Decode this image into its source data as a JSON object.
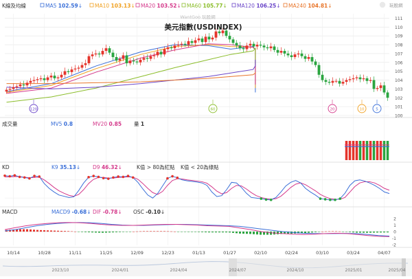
{
  "watermark": "WantGoo 玩股網",
  "logo_text": "玩股網",
  "chart_title": "美元指數(USDINDEX)",
  "colors": {
    "up": "#e5342b",
    "down": "#2aa53f",
    "ma5": "#3a6fd8",
    "ma10": "#f0a020",
    "ma20": "#d4388a",
    "ma60": "#8bbd2a",
    "ma120": "#6a45c8",
    "ma240": "#e8752a",
    "k": "#3a6fd8",
    "d": "#d4388a",
    "macd": "#3a6fd8",
    "dif": "#d4388a",
    "grid": "#e4e4e4"
  },
  "price_panel": {
    "label": "K線及均線",
    "legend": [
      {
        "name": "MA5",
        "value": "102.59",
        "dir": "↓",
        "key": "ma5"
      },
      {
        "name": "MA10",
        "value": "103.13",
        "dir": "↓",
        "key": "ma10"
      },
      {
        "name": "MA20",
        "value": "103.52",
        "dir": "↓",
        "key": "ma20"
      },
      {
        "name": "MA60",
        "value": "105.77",
        "dir": "↓",
        "key": "ma60"
      },
      {
        "name": "MA120",
        "value": "106.25",
        "dir": "↓",
        "key": "ma120"
      },
      {
        "name": "MA240",
        "value": "104.81",
        "dir": "↓",
        "key": "ma240"
      }
    ],
    "y_ticks": [
      "111",
      "110",
      "109",
      "108",
      "107",
      "106",
      "105",
      "104",
      "103",
      "102",
      "101",
      "100"
    ],
    "markers": [
      {
        "text": "120",
        "color": "#6a45c8"
      },
      {
        "text": "60",
        "color": "#8bbd2a"
      },
      {
        "text": "20",
        "color": "#d4388a"
      },
      {
        "text": "10",
        "color": "#f0a020"
      },
      {
        "text": "5",
        "color": "#3a6fd8"
      }
    ]
  },
  "volume_panel": {
    "label": "成交量",
    "legend": [
      {
        "name": "MV5",
        "value": "0.8",
        "key": "ma5"
      },
      {
        "name": "MV20",
        "value": "0.85",
        "key": "ma20"
      },
      {
        "name": "量",
        "value": "1",
        "key": "plain"
      }
    ]
  },
  "kd_panel": {
    "label": "KD",
    "legend": [
      {
        "name": "K9",
        "value": "35.13",
        "dir": "↓",
        "key": "k"
      },
      {
        "name": "D9",
        "value": "46.32",
        "dir": "↓",
        "key": "d"
      }
    ],
    "notes": [
      "K值 > 80為紅點",
      "K值 < 20為綠點"
    ]
  },
  "macd_panel": {
    "label": "MACD",
    "legend": [
      {
        "name": "MACD9",
        "value": "-0.68",
        "dir": "↓",
        "key": "macd"
      },
      {
        "name": "DIF",
        "value": "-0.78",
        "dir": "↓",
        "key": "dif"
      },
      {
        "name": "OSC",
        "value": "-0.10",
        "dir": "↓",
        "key": "plain"
      }
    ],
    "y_ticks": [
      "2",
      "1",
      "0",
      "-1",
      "-2"
    ]
  },
  "x_axis_labels": [
    "10/14",
    "10/28",
    "11/11",
    "11/25",
    "12/09",
    "12/23",
    "01/13",
    "01/27",
    "02/10",
    "02/24",
    "03/10",
    "03/24",
    "04/07"
  ],
  "navigator_labels": [
    "2023/10",
    "2024/01",
    "2024/04",
    "2024/07",
    "2024/10",
    "2025/01",
    "2025/04"
  ],
  "chart_data": {
    "type": "candlestick",
    "title": "美元指數(USDINDEX)",
    "ylim": [
      100,
      111.5
    ],
    "x_labels": [
      "10/14",
      "10/28",
      "11/11",
      "11/25",
      "12/09",
      "12/23",
      "01/13",
      "01/27",
      "02/10",
      "02/24",
      "03/10",
      "03/24",
      "04/07"
    ],
    "close": [
      102.9,
      103.0,
      103.2,
      103.3,
      103.5,
      103.4,
      103.7,
      103.9,
      104.0,
      104.1,
      104.2,
      104.0,
      104.3,
      104.5,
      104.2,
      104.3,
      104.6,
      105.0,
      104.9,
      105.2,
      105.3,
      105.4,
      105.7,
      105.9,
      106.7,
      106.9,
      107.0,
      106.9,
      107.3,
      107.6,
      107.1,
      106.6,
      106.2,
      106.4,
      106.8,
      105.9,
      106.2,
      106.1,
      106.0,
      106.3,
      106.5,
      106.4,
      106.7,
      106.8,
      107.2,
      106.9,
      107.5,
      107.7,
      107.6,
      107.9,
      108.0,
      108.1,
      108.0,
      108.4,
      108.2,
      108.5,
      108.7,
      108.3,
      108.9,
      108.6,
      108.8,
      109.5,
      109.3,
      109.6,
      109.0,
      108.6,
      108.2,
      107.9,
      107.6,
      107.5,
      107.9,
      108.1,
      107.8,
      108.0,
      107.9,
      107.7,
      107.6,
      107.8,
      107.4,
      107.1,
      107.3,
      107.0,
      106.8,
      106.6,
      106.9,
      107.0,
      106.7,
      106.4,
      106.6,
      106.1,
      105.7,
      104.6,
      104.0,
      103.8,
      103.7,
      103.9,
      103.9,
      103.6,
      103.8,
      104.0,
      104.1,
      104.2,
      104.3,
      104.1,
      104.2,
      103.9,
      104.0,
      103.0,
      103.1,
      103.4,
      102.6,
      102.0
    ],
    "series": [
      {
        "name": "MA5",
        "points": [
          [
            0,
            102.7
          ],
          [
            20,
            103.6
          ],
          [
            40,
            105.6
          ],
          [
            60,
            107.2
          ],
          [
            75,
            108.0
          ],
          [
            90,
            107.9
          ],
          [
            100,
            107.5
          ],
          [
            110,
            107.8
          ],
          [
            120,
            107.4
          ],
          [
            130,
            106.5
          ],
          [
            140,
            104.0
          ],
          [
            150,
            103.9
          ],
          [
            160,
            104.3
          ],
          [
            165,
            103.5
          ],
          [
            170,
            102.6
          ]
        ]
      },
      {
        "name": "MA10",
        "points": [
          [
            0,
            102.6
          ],
          [
            20,
            103.4
          ],
          [
            40,
            105.3
          ],
          [
            60,
            106.9
          ],
          [
            75,
            107.8
          ],
          [
            90,
            108.0
          ],
          [
            100,
            107.8
          ],
          [
            110,
            107.7
          ],
          [
            120,
            107.5
          ],
          [
            130,
            106.9
          ],
          [
            140,
            104.8
          ],
          [
            150,
            104.1
          ],
          [
            160,
            104.1
          ],
          [
            165,
            103.8
          ],
          [
            170,
            103.1
          ]
        ]
      },
      {
        "name": "MA20",
        "points": [
          [
            0,
            102.5
          ],
          [
            20,
            103.1
          ],
          [
            40,
            104.9
          ],
          [
            60,
            106.5
          ],
          [
            75,
            107.4
          ],
          [
            90,
            108.1
          ],
          [
            100,
            108.0
          ],
          [
            110,
            107.7
          ],
          [
            120,
            107.5
          ],
          [
            130,
            107.0
          ],
          [
            140,
            105.9
          ],
          [
            150,
            104.6
          ],
          [
            160,
            104.1
          ],
          [
            170,
            103.5
          ]
        ]
      },
      {
        "name": "MA60",
        "points": [
          [
            0,
            101.5
          ],
          [
            20,
            102.1
          ],
          [
            40,
            103.1
          ],
          [
            60,
            104.4
          ],
          [
            75,
            105.4
          ],
          [
            90,
            106.3
          ],
          [
            100,
            106.9
          ],
          [
            110,
            107.3
          ],
          [
            120,
            107.6
          ],
          [
            130,
            107.6
          ],
          [
            140,
            107.2
          ],
          [
            150,
            106.7
          ],
          [
            160,
            106.2
          ],
          [
            170,
            105.8
          ]
        ]
      },
      {
        "name": "MA120",
        "points": [
          [
            0,
            103.2
          ],
          [
            20,
            103.0
          ],
          [
            40,
            103.2
          ],
          [
            60,
            103.6
          ],
          [
            75,
            104.0
          ],
          [
            90,
            104.4
          ],
          [
            100,
            104.8
          ],
          [
            110,
            105.2
          ],
          [
            120,
            105.6
          ],
          [
            130,
            105.9
          ],
          [
            140,
            106.1
          ],
          [
            150,
            106.2
          ],
          [
            160,
            106.3
          ],
          [
            170,
            106.25
          ]
        ]
      },
      {
        "name": "MA240",
        "points": [
          [
            0,
            103.6
          ],
          [
            20,
            103.6
          ],
          [
            40,
            103.7
          ],
          [
            60,
            103.8
          ],
          [
            75,
            104.0
          ],
          [
            90,
            104.2
          ],
          [
            100,
            104.4
          ],
          [
            110,
            104.6
          ],
          [
            120,
            104.8
          ],
          [
            130,
            104.9
          ],
          [
            140,
            104.9
          ],
          [
            150,
            104.9
          ],
          [
            160,
            104.85
          ],
          [
            170,
            104.81
          ]
        ]
      }
    ],
    "kd": {
      "K": [
        94,
        92,
        95,
        90,
        88,
        85,
        93,
        91,
        68,
        52,
        40,
        30,
        26,
        22,
        24,
        45,
        70,
        89,
        93,
        90,
        86,
        84,
        88,
        91,
        90,
        93,
        88,
        72,
        50,
        30,
        20,
        35,
        60,
        85,
        92,
        87,
        80,
        77,
        75,
        73,
        70,
        62,
        40,
        25,
        28,
        48,
        72,
        70,
        55,
        36,
        22,
        20,
        18,
        15,
        14,
        22,
        40,
        60,
        72,
        78,
        70,
        52,
        40,
        30,
        18,
        16,
        14,
        14,
        18,
        36,
        62,
        77,
        80,
        76,
        70,
        62,
        52,
        40,
        35
      ],
      "D": [
        90,
        90,
        91,
        91,
        89,
        87,
        88,
        89,
        80,
        68,
        55,
        44,
        36,
        29,
        26,
        32,
        48,
        68,
        82,
        88,
        88,
        86,
        86,
        88,
        89,
        90,
        89,
        82,
        68,
        52,
        38,
        32,
        42,
        62,
        78,
        84,
        83,
        80,
        78,
        76,
        74,
        69,
        57,
        43,
        34,
        38,
        52,
        62,
        60,
        50,
        38,
        28,
        22,
        18,
        16,
        18,
        26,
        40,
        55,
        66,
        70,
        64,
        54,
        44,
        32,
        24,
        18,
        16,
        16,
        22,
        40,
        58,
        70,
        74,
        74,
        70,
        62,
        52,
        46
      ]
    },
    "macd": {
      "MACD": [
        0.1,
        0.3,
        0.6,
        0.9,
        1.1,
        1.25,
        1.35,
        1.4,
        1.35,
        1.25,
        1.1,
        1.0,
        0.95,
        0.95,
        1.0,
        1.05,
        1.1,
        1.1,
        1.05,
        1.0,
        0.95,
        0.9,
        0.8,
        0.6,
        0.4,
        0.2,
        0.0,
        -0.15,
        -0.25,
        -0.3,
        -0.32,
        -0.3,
        -0.28,
        -0.32,
        -0.45,
        -0.6,
        -0.68
      ],
      "DIF": [
        0.3,
        0.6,
        0.9,
        1.1,
        1.25,
        1.35,
        1.4,
        1.35,
        1.25,
        1.1,
        1.0,
        0.95,
        0.95,
        1.0,
        1.05,
        1.1,
        1.1,
        1.05,
        1.0,
        0.9,
        0.85,
        0.8,
        0.55,
        0.3,
        0.0,
        -0.2,
        -0.3,
        -0.4,
        -0.45,
        -0.4,
        -0.3,
        -0.25,
        -0.3,
        -0.45,
        -0.6,
        -0.72,
        -0.78
      ]
    },
    "volume": {
      "start_index": 99,
      "MV5": 0.8,
      "MV20": 0.85,
      "last": 1
    }
  }
}
